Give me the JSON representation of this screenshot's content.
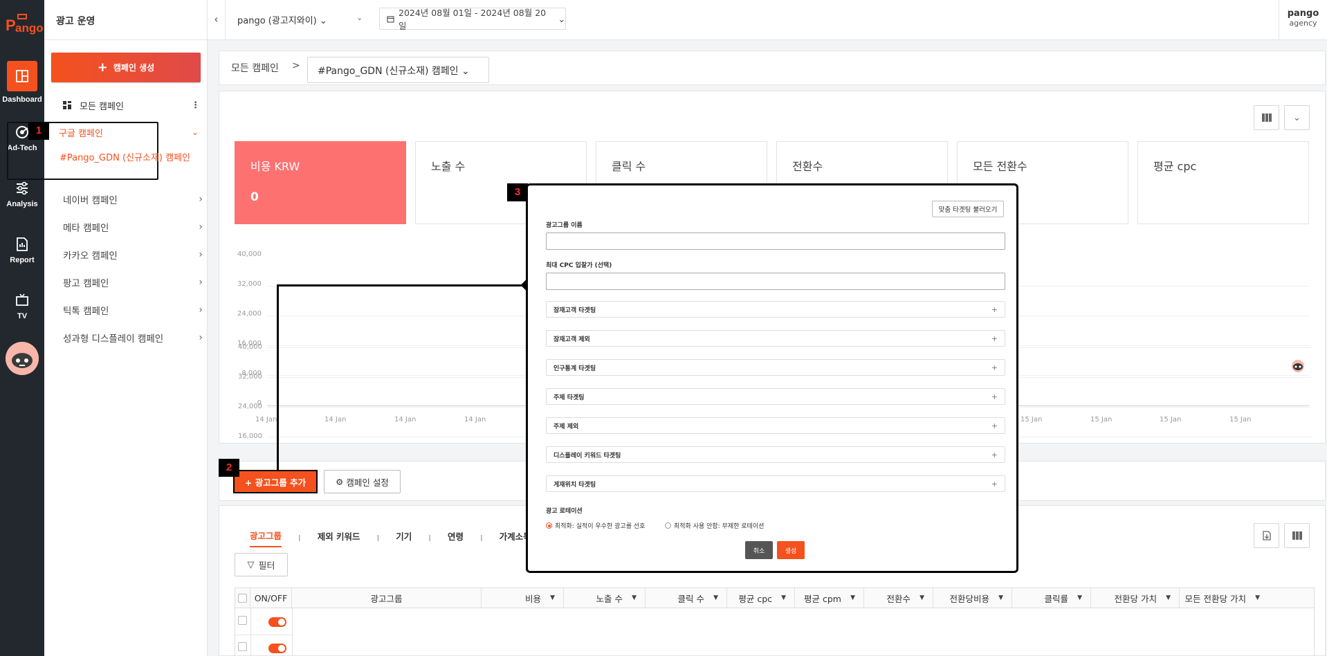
{
  "rail": {
    "logo_text": "Pango",
    "items": [
      {
        "label": "Dashboard",
        "icon": "dashboard-icon"
      },
      {
        "label": "Ad-Tech",
        "icon": "adtech-icon"
      },
      {
        "label": "Analysis",
        "icon": "sliders-icon"
      },
      {
        "label": "Report",
        "icon": "report-icon"
      },
      {
        "label": "TV",
        "icon": "tv-icon"
      }
    ]
  },
  "sidebar": {
    "title": "광고 운영",
    "create_button": "캠페인 생성",
    "all_campaigns": "모든 캠페인",
    "google": {
      "label": "구글 캠페인",
      "sub": "#Pango_GDN (신규소재) 캠페인"
    },
    "items": [
      "네이버 캠페인",
      "메타 캠페인",
      "카카오 캠페인",
      "팡고 캠페인",
      "틱톡 캠페인",
      "성과형 디스플레이 캠페인"
    ]
  },
  "badges": {
    "one": "1",
    "two": "2",
    "three": "3"
  },
  "header": {
    "account": "pango (광고지와이)",
    "date_range": "2024년 08월 01일 - 2024년 08월 20일",
    "agency_name": "pango",
    "agency_sub": "agency"
  },
  "breadcrumb": {
    "all": "모든 캠페인",
    "separator": ">",
    "current": "#Pango_GDN (신규소재) 캠페인"
  },
  "kpis": [
    {
      "label": "비용 KRW",
      "value": "0"
    },
    {
      "label": "노출 수",
      "value": ""
    },
    {
      "label": "클릭 수",
      "value": ""
    },
    {
      "label": "전환수",
      "value": ""
    },
    {
      "label": "모든 전환수",
      "value": ""
    },
    {
      "label": "평균 cpc",
      "value": ""
    }
  ],
  "chart": {
    "y_ticks": [
      "40,000",
      "32,000",
      "24,000",
      "16,000",
      "8,000",
      "0"
    ],
    "x_ticks": [
      "14 Jan",
      "14 Jan",
      "14 Jan",
      "14 Jan",
      "15 Jan",
      "15 Jan",
      "15 Jan",
      "15 Jan"
    ]
  },
  "actions": {
    "add_group": "+ 광고그룹 추가",
    "campaign_settings": "캠페인 설정"
  },
  "tabs": [
    "광고그룹",
    "제외 키워드",
    "기기",
    "연령",
    "가계소득"
  ],
  "tab_separator": "I",
  "filter_label": "필터",
  "table": {
    "columns": [
      "ON/OFF",
      "광고그룹",
      "비용",
      "노출 수",
      "클릭 수",
      "평균 cpc",
      "평균 cpm",
      "전환수",
      "전환당비용",
      "클릭률",
      "전환당 가치",
      "모든 전환당 가치"
    ]
  },
  "modal": {
    "load_button": "맞춤 타겟팅 불러오기",
    "name_label": "광고그룹 이름",
    "cpc_label": "최대 CPC 입찰가 (선택)",
    "accordions": [
      "잠재고객 타겟팅",
      "잠재고객 제외",
      "인구통계 타겟팅",
      "주제 타겟팅",
      "주제 제외",
      "디스플레이 키워드 타겟팅",
      "게재위치 타겟팅"
    ],
    "accordion_plus": "+",
    "rotation_label": "광고 로테이션",
    "rotation_options": [
      "최적화: 실적이 우수한 광고를 선호",
      "최적화 사용 안함: 무제한 로테이션"
    ],
    "cancel": "취소",
    "create": "생성"
  },
  "colors": {
    "accent": "#f4511e",
    "kpi_active": "#fd7171",
    "rail": "#23282f"
  }
}
